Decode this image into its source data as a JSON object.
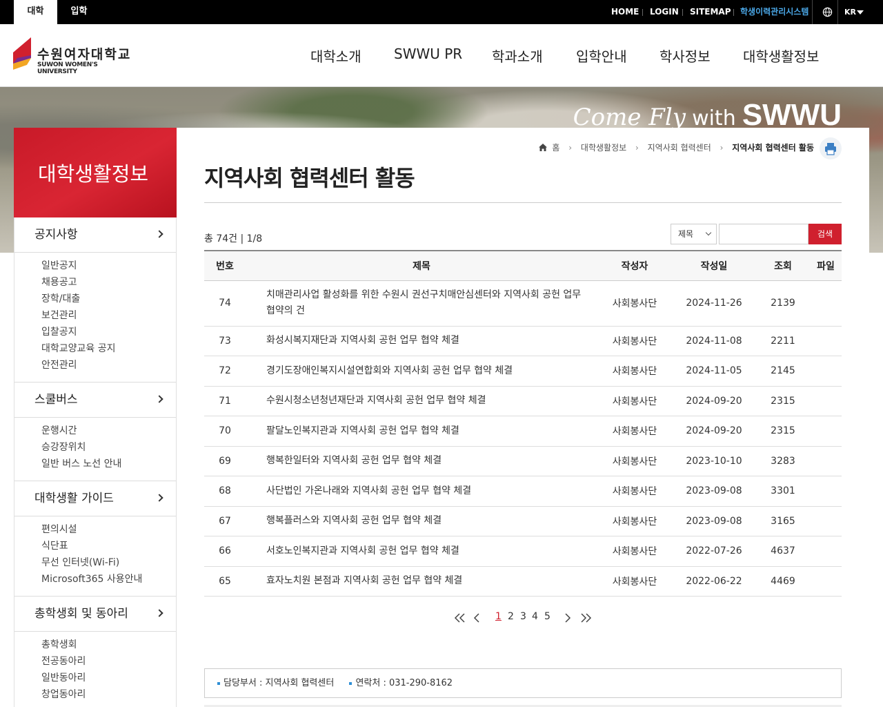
{
  "topbar": {
    "tabs": [
      "대학",
      "입학"
    ],
    "links": [
      "HOME",
      "LOGIN",
      "SITEMAP",
      "학생이력관리시스템"
    ],
    "language": "KR"
  },
  "header": {
    "logo_ko": "수원여자대학교",
    "logo_en": "SUWON WOMEN'S UNIVERSITY",
    "nav": [
      "대학소개",
      "SWWU PR",
      "학과소개",
      "입학안내",
      "학사정보",
      "대학생활정보"
    ]
  },
  "banner": {
    "script": "Come Fly",
    "with": "with",
    "brand": "SWWU"
  },
  "sidebar": {
    "title": "대학생활정보",
    "groups": [
      {
        "title": "공지사항",
        "items": [
          "일반공지",
          "채용공고",
          "장학/대출",
          "보건관리",
          "입찰공지",
          "대학교양교육 공지",
          "안전관리"
        ]
      },
      {
        "title": "스쿨버스",
        "items": [
          "운행시간",
          "승강장위치",
          "일반 버스 노선 안내"
        ]
      },
      {
        "title": "대학생활 가이드",
        "items": [
          "편의시설",
          "식단표",
          "무선 인터넷(Wi-Fi)",
          "Microsoft365 사용안내"
        ]
      },
      {
        "title": "총학생회 및 동아리",
        "items": [
          "총학생회",
          "전공동아리",
          "일반동아리",
          "창업동아리"
        ]
      }
    ]
  },
  "breadcrumb": [
    "홈",
    "대학생활정보",
    "지역사회 협력센터",
    "지역사회 협력센터 활동"
  ],
  "page_title": "지역사회 협력센터 활동",
  "board": {
    "count_text": "총 74건 | 1/8",
    "search": {
      "field": "제목",
      "button": "검색",
      "value": ""
    },
    "columns": [
      "번호",
      "제목",
      "작성자",
      "작성일",
      "조회",
      "파일"
    ],
    "rows": [
      {
        "no": "74",
        "title": "치매관리사업 활성화를 위한 수원시 권선구치매안심센터와 지역사회 공헌 업무 협약의 건",
        "author": "사회봉사단",
        "date": "2024-11-26",
        "views": "2139"
      },
      {
        "no": "73",
        "title": "화성시복지재단과 지역사회 공헌 업무 협약 체결",
        "author": "사회봉사단",
        "date": "2024-11-08",
        "views": "2211"
      },
      {
        "no": "72",
        "title": "경기도장애인복지시설연합회와 지역사회 공헌 업무 협약 체결",
        "author": "사회봉사단",
        "date": "2024-11-05",
        "views": "2145"
      },
      {
        "no": "71",
        "title": "수원시청소년청년재단과 지역사회 공헌 업무 협약 체결",
        "author": "사회봉사단",
        "date": "2024-09-20",
        "views": "2315"
      },
      {
        "no": "70",
        "title": "팔달노인복지관과 지역사회 공헌 업무 협약 체결",
        "author": "사회봉사단",
        "date": "2024-09-20",
        "views": "2315"
      },
      {
        "no": "69",
        "title": "행복한일터와 지역사회 공헌 업무 협약 체결",
        "author": "사회봉사단",
        "date": "2023-10-10",
        "views": "3283"
      },
      {
        "no": "68",
        "title": "사단법인 가온나래와 지역사회 공헌 업무 협약 체결",
        "author": "사회봉사단",
        "date": "2023-09-08",
        "views": "3301"
      },
      {
        "no": "67",
        "title": "행복플러스와 지역사회 공헌 업무 협약 체결",
        "author": "사회봉사단",
        "date": "2023-09-08",
        "views": "3165"
      },
      {
        "no": "66",
        "title": "서호노인복지관과 지역사회 공헌 업무 협약 체결",
        "author": "사회봉사단",
        "date": "2022-07-26",
        "views": "4637"
      },
      {
        "no": "65",
        "title": "효자노치원 본점과 지역사회 공헌 업무 협약 체결",
        "author": "사회봉사단",
        "date": "2022-06-22",
        "views": "4469"
      }
    ]
  },
  "pagination": {
    "pages": [
      "1",
      "2",
      "3",
      "4",
      "5"
    ],
    "current": "1"
  },
  "info": {
    "department": "담당부서 : 지역사회 협력센터",
    "contact": "연락처 : 031-290-8162"
  },
  "colors": {
    "accent": "#d0202e",
    "highlight": "#4ba8e8"
  }
}
